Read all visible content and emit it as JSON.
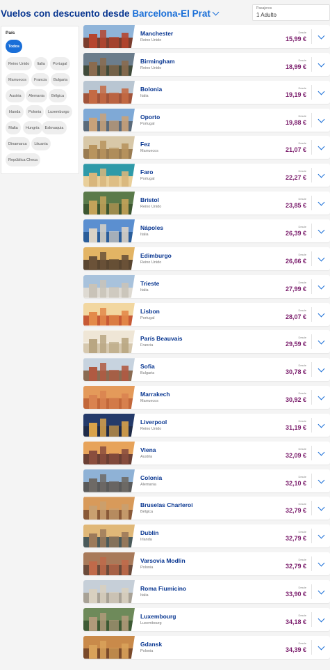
{
  "header": {
    "title_prefix": "Vuelos con descuento desde",
    "origin": "Barcelona-El Prat",
    "passengers_label": "Pasajeros",
    "passengers_value": "1 Adulto"
  },
  "filter": {
    "label": "País",
    "chips": [
      "Todos",
      "Reino Unido",
      "Italia",
      "Portugal",
      "Marruecos",
      "Francia",
      "Bulgaria",
      "Austria",
      "Alemania",
      "Bélgica",
      "Irlanda",
      "Polonia",
      "Luxemburgo",
      "Malta",
      "Hungría",
      "Eslovaquia",
      "Dinamarca",
      "Lituania",
      "República Checa"
    ],
    "active": "Todos"
  },
  "desde_label": "Desde",
  "flights": [
    {
      "city": "Manchester",
      "country": "Reino Unido",
      "price": "15,99 €",
      "sky": "#8fb4d9",
      "ground": "#7a3d2e",
      "bld": "#b5452f"
    },
    {
      "city": "Birmingham",
      "country": "Reino Unido",
      "price": "18,99 €",
      "sky": "#6b7d8c",
      "ground": "#3f4a3a",
      "bld": "#8a6b4f"
    },
    {
      "city": "Bolonia",
      "country": "Italia",
      "price": "19,19 €",
      "sky": "#b9c6d2",
      "ground": "#a1543a",
      "bld": "#c46a44"
    },
    {
      "city": "Oporto",
      "country": "Portugal",
      "price": "19,88 €",
      "sky": "#7fa9d6",
      "ground": "#5a6a7a",
      "bld": "#c9a27a"
    },
    {
      "city": "Fez",
      "country": "Marruecos",
      "price": "21,07 €",
      "sky": "#d8c8a8",
      "ground": "#9a7c52",
      "bld": "#b8945e"
    },
    {
      "city": "Faro",
      "country": "Portugal",
      "price": "22,27 €",
      "sky": "#2f9aa8",
      "ground": "#e9cf9a",
      "bld": "#d8b67c"
    },
    {
      "city": "Bristol",
      "country": "Reino Unido",
      "price": "23,85 €",
      "sky": "#5a7a4a",
      "ground": "#3c5630",
      "bld": "#c4a35a"
    },
    {
      "city": "Nápoles",
      "country": "Italia",
      "price": "26,39 €",
      "sky": "#5b8fd0",
      "ground": "#2a5d9a",
      "bld": "#d9d2c6"
    },
    {
      "city": "Edimburgo",
      "country": "Reino Unido",
      "price": "26,66 €",
      "sky": "#e3b464",
      "ground": "#5a4630",
      "bld": "#6b5238"
    },
    {
      "city": "Trieste",
      "country": "Italia",
      "price": "27,99 €",
      "sky": "#a8c2dc",
      "ground": "#dedad2",
      "bld": "#c9c3b8"
    },
    {
      "city": "Lisbon",
      "country": "Portugal",
      "price": "28,07 €",
      "sky": "#f2d7a0",
      "ground": "#c75a35",
      "bld": "#e38a4a"
    },
    {
      "city": "París Beauvais",
      "country": "Francia",
      "price": "29,59 €",
      "sky": "#efe6d6",
      "ground": "#d6c8ae",
      "bld": "#b9a682"
    },
    {
      "city": "Sofia",
      "country": "Bulgaria",
      "price": "30,78 €",
      "sky": "#c7d3df",
      "ground": "#8a6b52",
      "bld": "#b05a42"
    },
    {
      "city": "Marrakech",
      "country": "Marruecos",
      "price": "30,92 €",
      "sky": "#e49a5a",
      "ground": "#c2673a",
      "bld": "#d98350"
    },
    {
      "city": "Liverpool",
      "country": "Reino Unido",
      "price": "31,19 €",
      "sky": "#243a6a",
      "ground": "#1f2b48",
      "bld": "#d9a24a"
    },
    {
      "city": "Viena",
      "country": "Austria",
      "price": "32,09 €",
      "sky": "#e7a35a",
      "ground": "#6a3f34",
      "bld": "#8a4e3e"
    },
    {
      "city": "Colonia",
      "country": "Alemania",
      "price": "32,10 €",
      "sky": "#8fb2d6",
      "ground": "#5a5a5a",
      "bld": "#6e6a66"
    },
    {
      "city": "Bruselas Charleroi",
      "country": "Bélgica",
      "price": "32,79 €",
      "sky": "#d89a5a",
      "ground": "#8a5a38",
      "bld": "#c9a070"
    },
    {
      "city": "Dublín",
      "country": "Irlanda",
      "price": "32,79 €",
      "sky": "#e0b878",
      "ground": "#4a5a5a",
      "bld": "#9c7a5a"
    },
    {
      "city": "Varsovia Modlin",
      "country": "Polonia",
      "price": "32,79 €",
      "sky": "#a87a5a",
      "ground": "#6a4a3a",
      "bld": "#c06a4a"
    },
    {
      "city": "Roma Fiumicino",
      "country": "Italia",
      "price": "33,90 €",
      "sky": "#c6cfd8",
      "ground": "#a8a296",
      "bld": "#d8d0c0"
    },
    {
      "city": "Luxembourg",
      "country": "Luxembourg",
      "price": "34,18 €",
      "sky": "#6e8a5a",
      "ground": "#3e5a34",
      "bld": "#b09a7a"
    },
    {
      "city": "Gdansk",
      "country": "Polonia",
      "price": "34,39 €",
      "sky": "#c98a4a",
      "ground": "#7a4a2a",
      "bld": "#d9a25a"
    }
  ]
}
